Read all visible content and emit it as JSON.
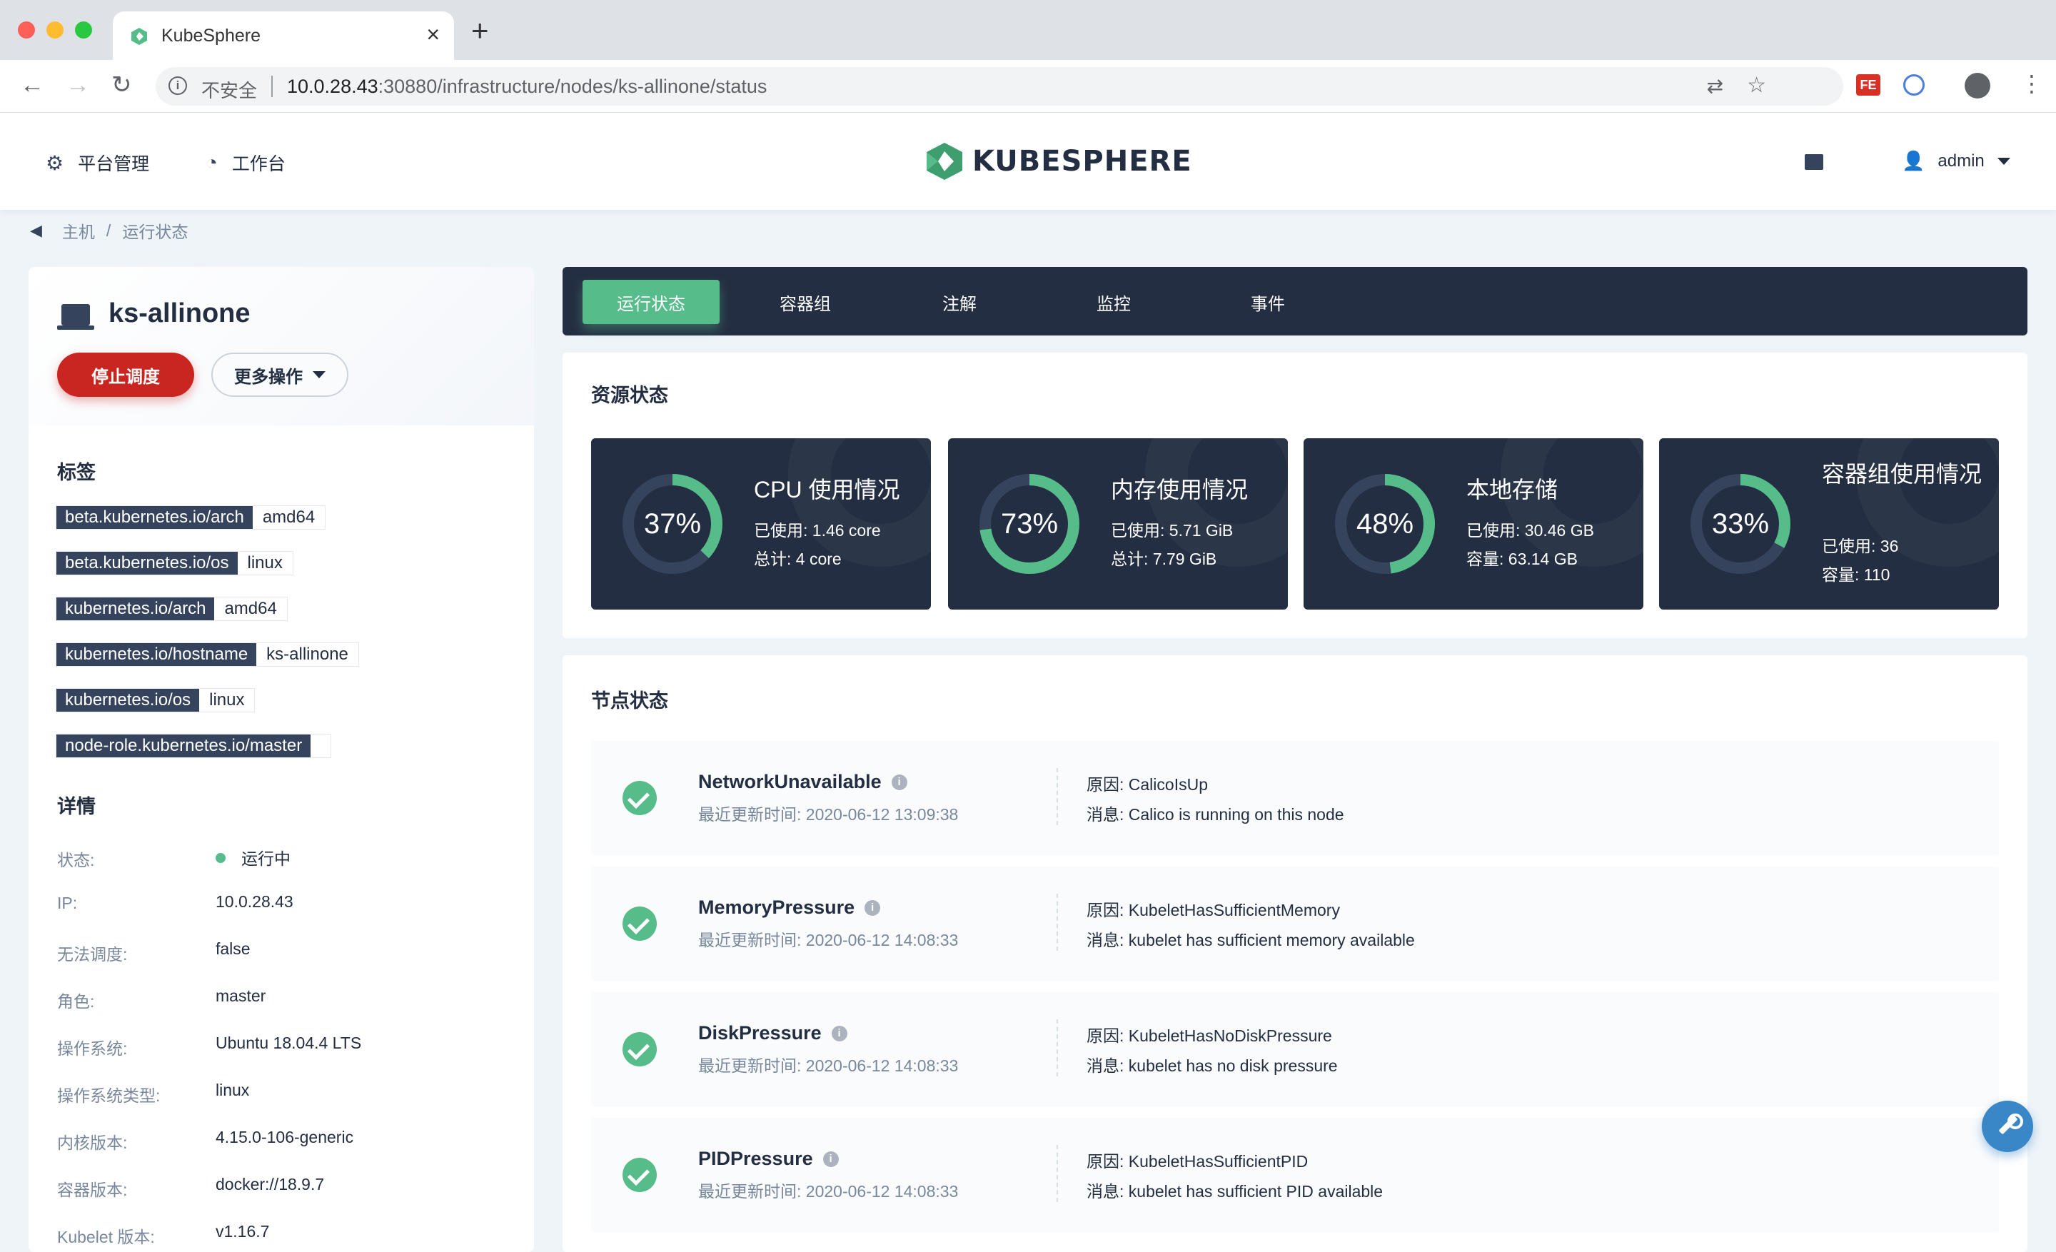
{
  "browser": {
    "tab_title": "KubeSphere",
    "url_insecure": "不安全",
    "url_host": "10.0.28.43",
    "url_path": ":30880/infrastructure/nodes/ks-allinone/status"
  },
  "header": {
    "platform_label": "平台管理",
    "workbench_label": "工作台",
    "logo_text": "KUBESPHERE",
    "user": "admin"
  },
  "breadcrumb": {
    "parent": "主机",
    "separator": "/",
    "current": "运行状态"
  },
  "node": {
    "name": "ks-allinone",
    "stop_label": "停止调度",
    "more_label": "更多操作",
    "labels_title": "标签",
    "labels": [
      {
        "key": "beta.kubernetes.io/arch",
        "value": "amd64"
      },
      {
        "key": "beta.kubernetes.io/os",
        "value": "linux"
      },
      {
        "key": "kubernetes.io/arch",
        "value": "amd64"
      },
      {
        "key": "kubernetes.io/hostname",
        "value": "ks-allinone"
      },
      {
        "key": "kubernetes.io/os",
        "value": "linux"
      },
      {
        "key": "node-role.kubernetes.io/master",
        "value": ""
      }
    ],
    "details_title": "详情",
    "details": [
      {
        "key": "状态:",
        "value": "运行中"
      },
      {
        "key": "IP:",
        "value": "10.0.28.43"
      },
      {
        "key": "无法调度:",
        "value": "false"
      },
      {
        "key": "角色:",
        "value": "master"
      },
      {
        "key": "操作系统:",
        "value": "Ubuntu 18.04.4 LTS"
      },
      {
        "key": "操作系统类型:",
        "value": "linux"
      },
      {
        "key": "内核版本:",
        "value": "4.15.0-106-generic"
      },
      {
        "key": "容器版本:",
        "value": "docker://18.9.7"
      },
      {
        "key": "Kubelet 版本:",
        "value": "v1.16.7"
      }
    ]
  },
  "tabs": [
    "运行状态",
    "容器组",
    "注解",
    "监控",
    "事件"
  ],
  "resources": {
    "title": "资源状态",
    "items": [
      {
        "title": "CPU 使用情况",
        "percent": 37,
        "percent_label": "37%",
        "line1": "已使用: 1.46 core",
        "line2": "总计: 4 core"
      },
      {
        "title": "内存使用情况",
        "percent": 73,
        "percent_label": "73%",
        "line1": "已使用: 5.71 GiB",
        "line2": "总计: 7.79 GiB"
      },
      {
        "title": "本地存储",
        "percent": 48,
        "percent_label": "48%",
        "line1": "已使用: 30.46 GB",
        "line2": "容量: 63.14 GB"
      },
      {
        "title": "容器组使用情况",
        "percent": 33,
        "percent_label": "33%",
        "line1": "已使用: 36",
        "line2": "容量: 110"
      }
    ]
  },
  "conditions": {
    "title": "节点状态",
    "items": [
      {
        "name": "NetworkUnavailable",
        "time": "最近更新时间: 2020-06-12 13:09:38",
        "reason": "原因: CalicoIsUp",
        "message": "消息: Calico is running on this node"
      },
      {
        "name": "MemoryPressure",
        "time": "最近更新时间: 2020-06-12 14:08:33",
        "reason": "原因: KubeletHasSufficientMemory",
        "message": "消息: kubelet has sufficient memory available"
      },
      {
        "name": "DiskPressure",
        "time": "最近更新时间: 2020-06-12 14:08:33",
        "reason": "原因: KubeletHasNoDiskPressure",
        "message": "消息: kubelet has no disk pressure"
      },
      {
        "name": "PIDPressure",
        "time": "最近更新时间: 2020-06-12 14:08:33",
        "reason": "原因: KubeletHasSufficientPID",
        "message": "消息: kubelet has sufficient PID available"
      }
    ]
  },
  "colors": {
    "accent": "#55bc8a",
    "dark": "#242e42",
    "danger": "#ca2621"
  }
}
